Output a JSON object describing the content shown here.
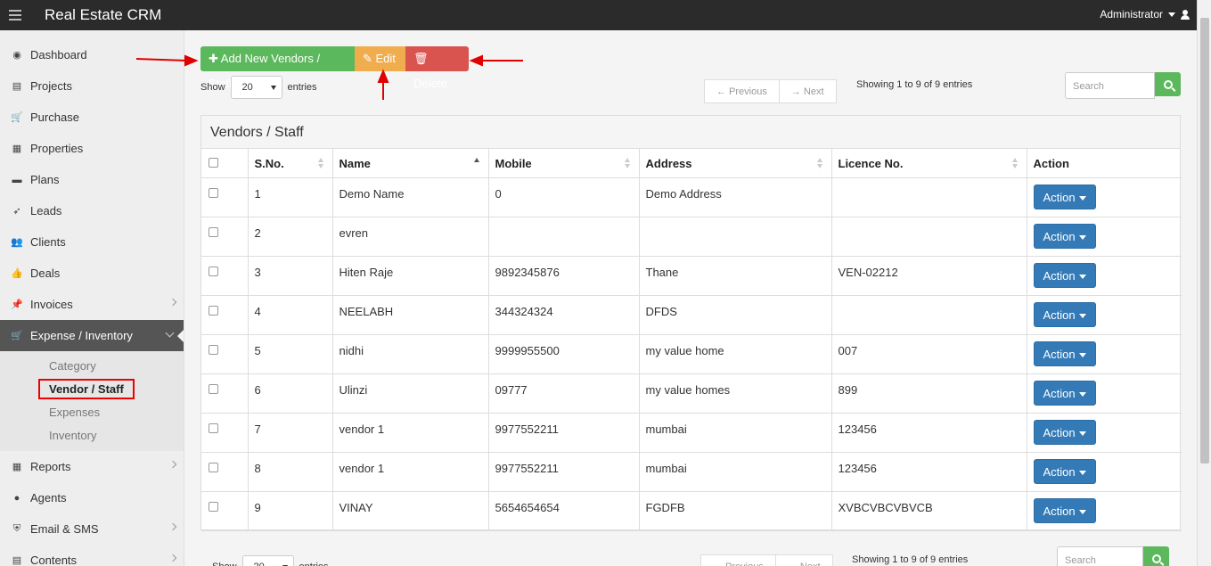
{
  "app": {
    "title": "Real Estate CRM",
    "user": "Administrator"
  },
  "sidebar": {
    "items": [
      {
        "label": "Dashboard",
        "icon": "dashboard-icon"
      },
      {
        "label": "Projects",
        "icon": "server-icon"
      },
      {
        "label": "Purchase",
        "icon": "cart-icon"
      },
      {
        "label": "Properties",
        "icon": "building-icon"
      },
      {
        "label": "Plans",
        "icon": "briefcase-icon"
      },
      {
        "label": "Leads",
        "icon": "rocket-icon"
      },
      {
        "label": "Clients",
        "icon": "users-icon"
      },
      {
        "label": "Deals",
        "icon": "thumbs-up-icon"
      },
      {
        "label": "Invoices",
        "icon": "pin-icon"
      },
      {
        "label": "Expense / Inventory",
        "icon": "cart-icon"
      }
    ],
    "submenu": [
      "Category",
      "Vendor / Staff",
      "Expenses",
      "Inventory"
    ],
    "lower_items": [
      {
        "label": "Reports",
        "icon": "table-icon"
      },
      {
        "label": "Agents",
        "icon": "user-secret-icon"
      },
      {
        "label": "Email & SMS",
        "icon": "shield-icon"
      },
      {
        "label": "Contents",
        "icon": "newspaper-icon"
      }
    ]
  },
  "toolbar": {
    "add_label": "Add New Vendors / Staff",
    "edit_label": "Edit",
    "delete_label": "Delete"
  },
  "listing": {
    "show_label": "Show",
    "entries_value": "20",
    "entries_label": "entries",
    "previous_label": "← Previous",
    "next_label": "→ Next",
    "showing_text": "Showing 1 to 9 of 9 entries",
    "search_placeholder": "Search"
  },
  "panel": {
    "title": "Vendors / Staff"
  },
  "table": {
    "headers": [
      "",
      "S.No.",
      "Name",
      "Mobile",
      "Address",
      "Licence No.",
      "Action"
    ],
    "action_label": "Action",
    "rows": [
      [
        "1",
        "Demo Name",
        "0",
        "Demo Address",
        ""
      ],
      [
        "2",
        "evren",
        "",
        "",
        ""
      ],
      [
        "3",
        "Hiten Raje",
        "9892345876",
        "Thane",
        "VEN-02212"
      ],
      [
        "4",
        "NEELABH",
        "344324324",
        "DFDS",
        ""
      ],
      [
        "5",
        "nidhi",
        "9999955500",
        "my value home",
        "007"
      ],
      [
        "6",
        "Ulinzi",
        "09777",
        "my value homes",
        "899"
      ],
      [
        "7",
        "vendor 1",
        "9977552211",
        "mumbai",
        "123456"
      ],
      [
        "8",
        "vendor 1",
        "9977552211",
        "mumbai",
        "123456"
      ],
      [
        "9",
        "VINAY",
        "5654654654",
        "FGDFB",
        "XVBCVBCVBVCB"
      ]
    ]
  },
  "colors": {
    "topbar": "#2b2b2b",
    "add": "#5cb85c",
    "edit": "#f0ad4e",
    "delete": "#d9534f",
    "action": "#337ab7",
    "annotation": "#e00000"
  }
}
